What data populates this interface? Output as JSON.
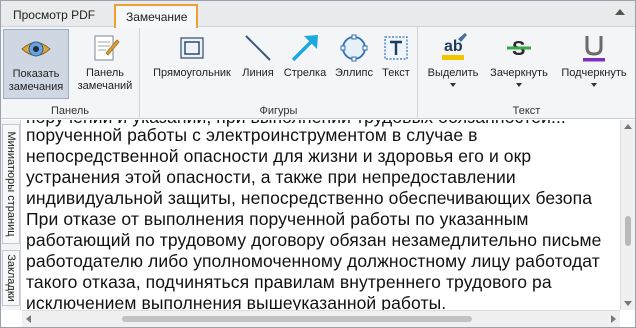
{
  "tabs": {
    "pdf_viewer": "Просмотр PDF",
    "annotation": "Замечание"
  },
  "ribbon": {
    "panel_group": {
      "label": "Панель",
      "show_annotations": "Показать замечания",
      "annotations_panel": "Панель замечаний"
    },
    "shapes_group": {
      "label": "Фигуры",
      "rectangle": "Прямоугольник",
      "line": "Линия",
      "arrow": "Стрелка",
      "ellipse": "Эллипс",
      "text": "Текст"
    },
    "text_group": {
      "label": "Текст",
      "highlight": "Выделить",
      "strikeout": "Зачеркнуть",
      "underline": "Подчеркнуть"
    }
  },
  "side_tabs": {
    "thumbnails": "Миниатюры страниц",
    "bookmarks": "Закладки"
  },
  "document": {
    "lines": [
      "поручений и указаний, при выполнении трудовых обязанностей...",
      "порученной     работы     с     электроинструментом     в     случае     в",
      "непосредственной опасности для жизни и здоровья его и окр",
      "устранения  этой  опасности,  а  также  при  непредоставлении",
      "индивидуальной защиты, непосредственно обеспечивающих безопа",
      "При  отказе  от  выполнения  порученной  работы  по  указанным",
      "работающий по трудовому договору обязан незамедлительно письме",
      "работодателю либо уполномоченному должностному лицу работодат",
      "такого  отказа,  подчиняться  правилам  внутреннего  трудового  ра",
      "исключением выполнения вышеуказанной работы."
    ]
  },
  "colors": {
    "active_tab_border": "#f0a030",
    "highlight_yellow": "#f2c500",
    "strike_green": "#3aa84a",
    "underline_purple": "#7b2fbf",
    "arrow_cyan": "#1ea7e1"
  }
}
